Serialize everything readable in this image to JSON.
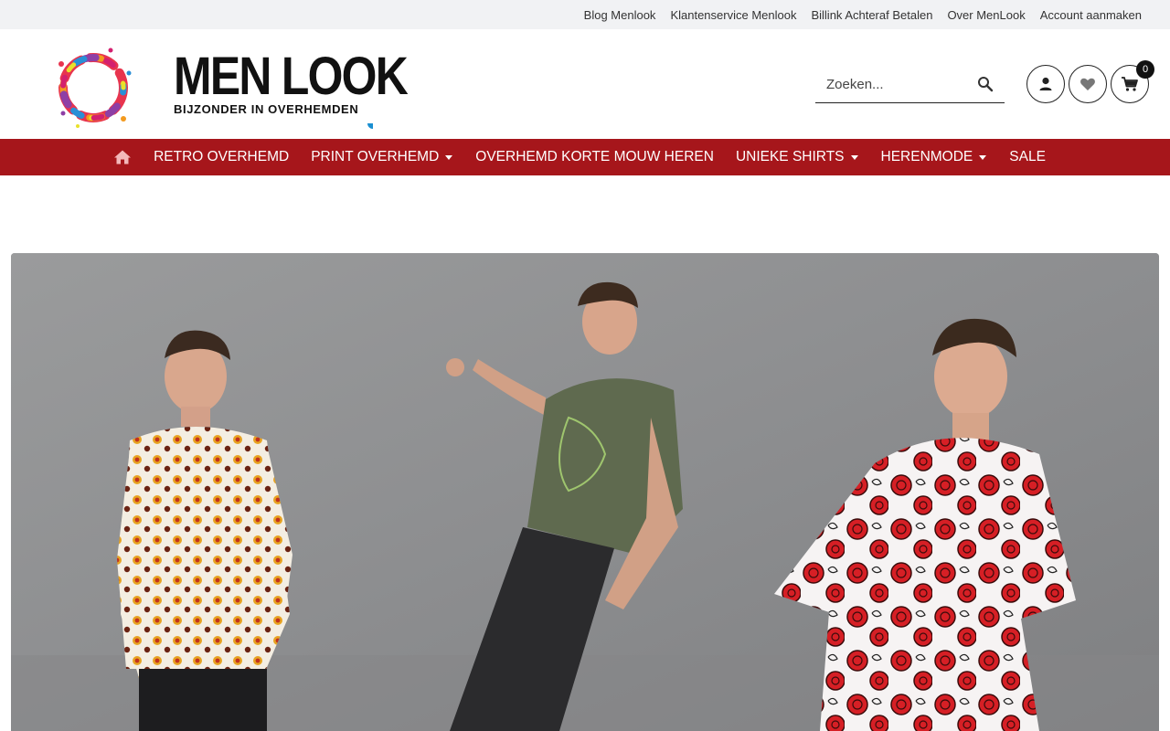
{
  "topbar": {
    "links": [
      "Blog Menlook",
      "Klantenservice Menlook",
      "Billink Achteraf Betalen",
      "Over MenLook",
      "Account aanmaken"
    ]
  },
  "logo": {
    "title": "MEN LOOK",
    "tagline": "BIJZONDER IN OVERHEMDEN"
  },
  "search": {
    "placeholder": "Zoeken..."
  },
  "cart": {
    "count": "0"
  },
  "nav": {
    "items": [
      "RETRO OVERHEMD",
      "PRINT OVERHEMD",
      "OVERHEMD KORTE MOUW HEREN",
      "UNIEKE SHIRTS",
      "HERENMODE",
      "SALE"
    ]
  },
  "colors": {
    "nav_bg": "#a6161b",
    "topbar_bg": "#f1f2f4"
  },
  "icons": [
    "home-icon",
    "chevron-down-icon",
    "search-icon",
    "user-icon",
    "heart-icon",
    "cart-icon"
  ]
}
